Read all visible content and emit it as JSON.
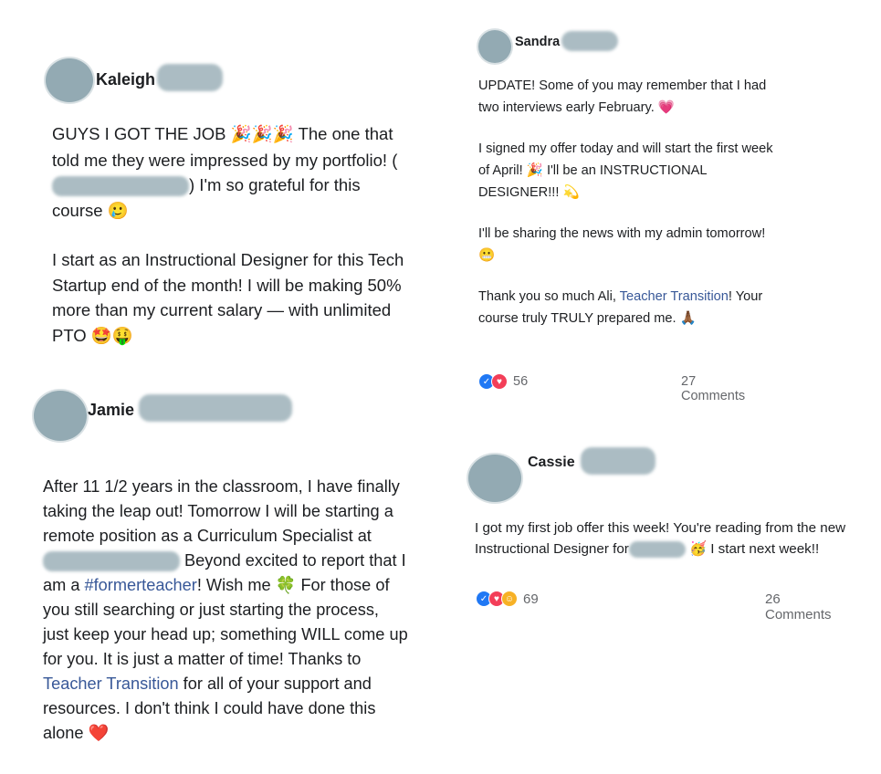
{
  "posts": {
    "kaleigh": {
      "name": "Kaleigh",
      "line1_a": "GUYS I GOT THE JOB ",
      "line1_emoji": "🎉🎉🎉",
      "line1_b": " The one that told me they were impressed by my portfolio! (",
      "line1_c": ") I'm so grateful for this course ",
      "line1_emoji2": "🥲",
      "paragraph2": "I start as an Instructional Designer for this Tech Startup end of the month! I will be making 50% more than my current salary — with unlimited PTO ",
      "paragraph2_emoji": "🤩🤑"
    },
    "jamie": {
      "name": "Jamie",
      "text_a": "After 11 1/2 years in the classroom, I have finally taking the leap out! Tomorrow I will be starting a remote position as a Curriculum Specialist at ",
      "text_b": " Beyond excited to report that I am a ",
      "hashtag": "#formerteacher",
      "text_c": "! Wish me ",
      "emoji_clover": "🍀",
      "text_d": " For those of you still searching or just starting the process, just keep your head up; something WILL come up for you. It is just a matter of time! Thanks to ",
      "link": "Teacher Transition",
      "text_e": " for all of your support and resources. I don't think I could have done this alone ",
      "emoji_heart": "❤️"
    },
    "sandra": {
      "name": "Sandra",
      "p1": "UPDATE! Some of you may remember that I had two interviews early February. ",
      "p1_emoji": "💗",
      "p2": "I signed my offer today and will start the first week of April! ",
      "p2_emoji": "🎉",
      "p2b": " I'll be an INSTRUCTIONAL DESIGNER!!! ",
      "p2_emoji2": "💫",
      "p3": "I'll be sharing the news with my admin tomorrow! ",
      "p3_emoji": "😬",
      "p4_a": "Thank you so much Ali, ",
      "p4_link": "Teacher Transition",
      "p4_b": "! Your course truly TRULY prepared me. ",
      "p4_emoji": "🙏🏾",
      "reactions_count": "56",
      "comments": "27 Comments"
    },
    "cassie": {
      "name": "Cassie",
      "text_a": "I got my first job offer this week! You're reading from the new Instructional Designer for",
      "text_b": " ",
      "emoji": "🥳",
      "text_c": " I start next week!!",
      "reactions_count": "69",
      "comments": "26 Comments"
    }
  },
  "icons": {
    "like": "👍",
    "love": "❤",
    "care": "🤗"
  },
  "colors": {
    "link": "#385898",
    "blur": "#9db1b9",
    "muted": "#65676b"
  }
}
